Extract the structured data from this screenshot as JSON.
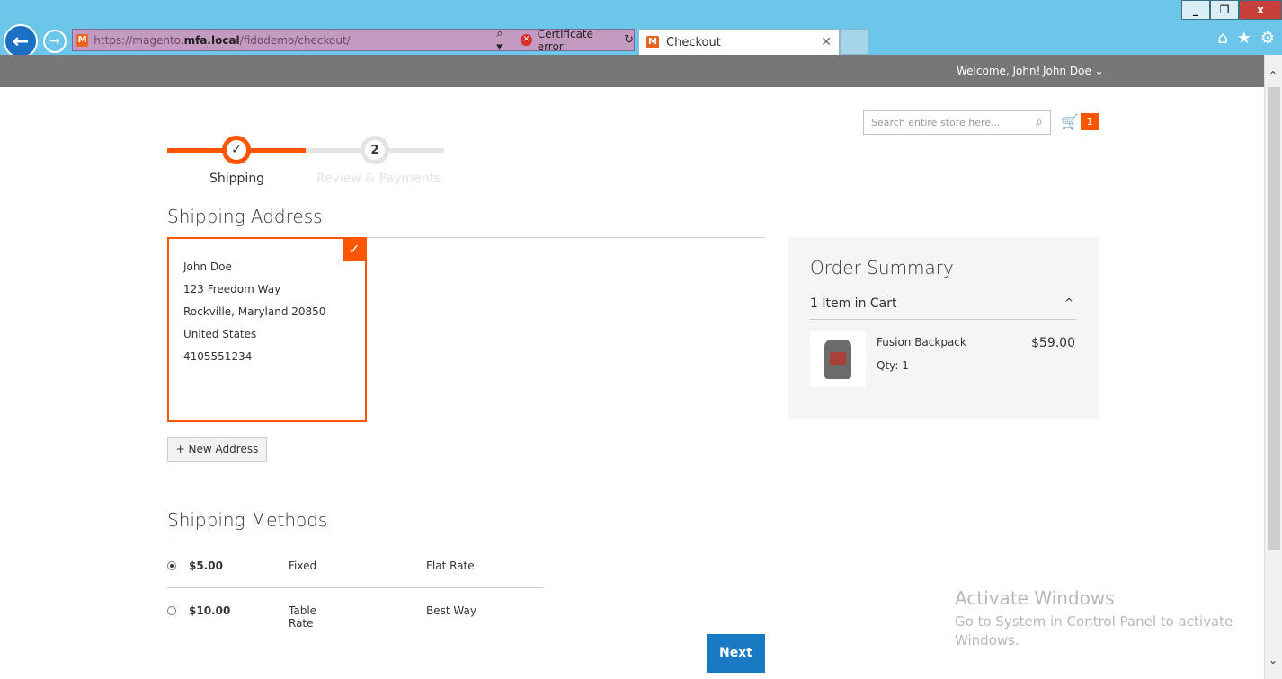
{
  "browser": {
    "url_prefix": "https://magento.",
    "url_domain": "mfa.local",
    "url_path": "/fidodemo/checkout/",
    "certificate": "Certificate error",
    "tab_title": "Checkout",
    "logo_letter": "M",
    "min_btn": "_",
    "restore_btn": "❐",
    "close_btn": "x"
  },
  "header": {
    "welcome": "Welcome, John!",
    "user": "John Doe ⌄"
  },
  "search": {
    "placeholder": "Search entire store here..."
  },
  "cart": {
    "count": "1"
  },
  "progress": {
    "step1_label": "Shipping",
    "step2_number": "2",
    "step2_label": "Review & Payments"
  },
  "shipping_address": {
    "title": "Shipping Address",
    "lines": [
      "John Doe",
      "123 Freedom Way",
      "Rockville, Maryland 20850",
      "United States",
      "4105551234"
    ],
    "new_address": "+ New Address"
  },
  "shipping_methods": {
    "title": "Shipping Methods",
    "rows": [
      {
        "price": "$5.00",
        "method": "Fixed",
        "carrier": "Flat Rate",
        "selected": true
      },
      {
        "price": "$10.00",
        "method": "Table Rate",
        "carrier": "Best Way",
        "selected": false
      }
    ],
    "next": "Next"
  },
  "order_summary": {
    "title": "Order Summary",
    "items_in_cart": "1 Item in Cart",
    "product_name": "Fusion Backpack",
    "qty": "Qty: 1",
    "price": "$59.00"
  },
  "watermark": {
    "title": "Activate Windows",
    "text": "Go to System in Control Panel to activate Windows."
  },
  "colors": {
    "accent": "#ff5501",
    "primary": "#1979c3",
    "chrome": "#6cc6e9"
  }
}
